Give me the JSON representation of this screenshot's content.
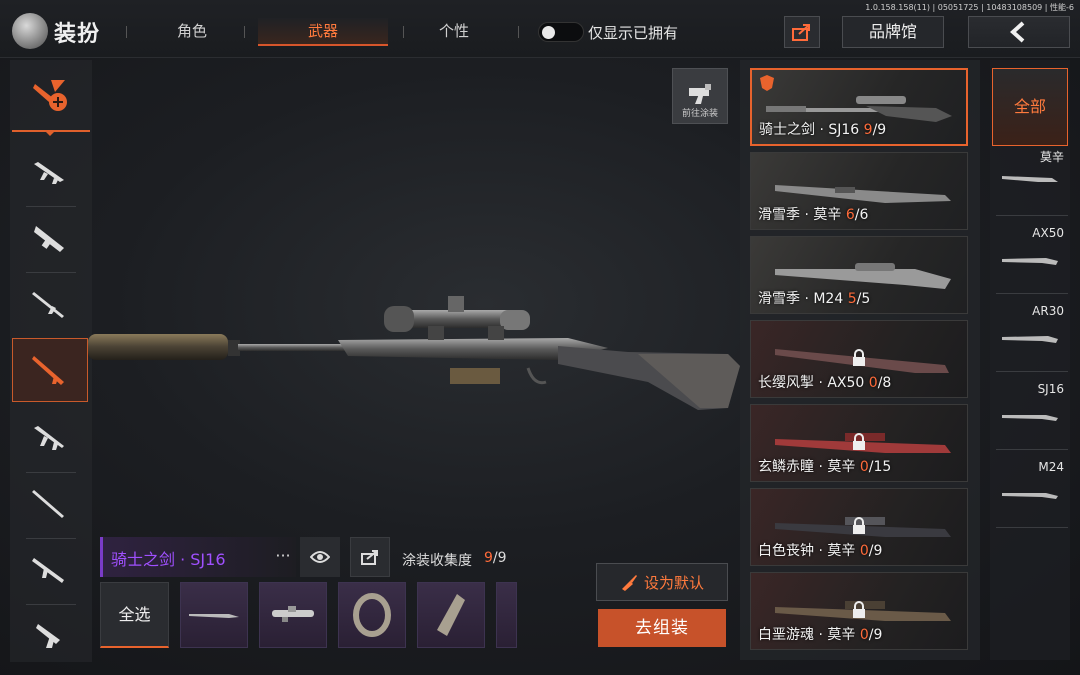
{
  "header": {
    "title": "装扮",
    "tabs": [
      {
        "label": "角色",
        "active": false
      },
      {
        "label": "武器",
        "active": true
      },
      {
        "label": "个性",
        "active": false
      }
    ],
    "owned_only_toggle": {
      "label": "仅显示已拥有",
      "on": false
    },
    "version_text": "1.0.158.158(11) | 05051725 | 10483108509 | 性能-6",
    "brand_hall_label": "品牌馆"
  },
  "left_sidebar": {
    "items": [
      {
        "icon": "skin-paint-icon",
        "active": true
      },
      {
        "icon": "assault-rifle-icon",
        "active": false
      },
      {
        "icon": "smg-icon",
        "active": false
      },
      {
        "icon": "shotgun-icon",
        "active": false
      },
      {
        "icon": "sniper-rifle-icon",
        "active": true
      },
      {
        "icon": "rifle-icon",
        "active": false
      },
      {
        "icon": "marksman-rifle-icon",
        "active": false
      },
      {
        "icon": "lmg-icon",
        "active": false
      },
      {
        "icon": "pistol-icon",
        "active": false
      }
    ]
  },
  "go_paint_label": "前往涂装",
  "skin_list": [
    {
      "name": "骑士之剑 · SJ16 ",
      "owned": "9",
      "total": "/9",
      "locked": false,
      "selected": true
    },
    {
      "name": "滑雪季 · 莫辛 ",
      "owned": "6",
      "total": "/6",
      "locked": false,
      "selected": false
    },
    {
      "name": "滑雪季 · M24 ",
      "owned": "5",
      "total": "/5",
      "locked": false,
      "selected": false
    },
    {
      "name": "长缨风掣 · AX50 ",
      "owned": "0",
      "total": "/8",
      "locked": true,
      "selected": false
    },
    {
      "name": "玄鳞赤瞳 · 莫辛 ",
      "owned": "0",
      "total": "/15",
      "locked": true,
      "selected": false
    },
    {
      "name": "白色丧钟 · 莫辛 ",
      "owned": "0",
      "total": "/9",
      "locked": true,
      "selected": false
    },
    {
      "name": "白垩游魂 · 莫辛 ",
      "owned": "0",
      "total": "/9",
      "locked": true,
      "selected": false
    }
  ],
  "weapon_filter": {
    "all_label": "全部",
    "items": [
      "莫辛",
      "AX50",
      "AR30",
      "SJ16",
      "M24"
    ]
  },
  "selected_skin": {
    "title": "骑士之剑 · SJ16",
    "more_label": "···",
    "collection_label": "涂装收集度",
    "collection_owned": "9",
    "collection_total": "/9"
  },
  "parts": {
    "select_all_label": "全选",
    "slots": [
      "rifle-part-icon",
      "scope-part-icon",
      "sling-part-icon",
      "stock-part-icon"
    ]
  },
  "actions": {
    "set_default_label": "设为默认",
    "assemble_label": "去组装"
  },
  "colors": {
    "accent": "#e8632d",
    "purple_rarity": "#a050ff"
  }
}
